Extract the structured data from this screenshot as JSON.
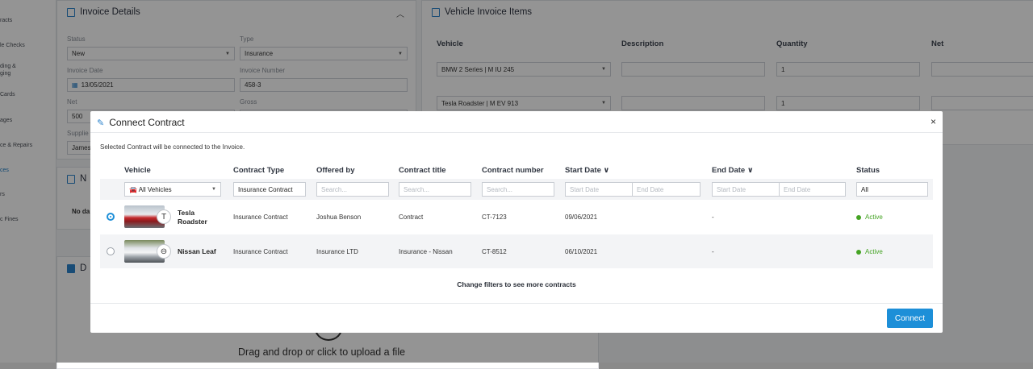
{
  "sidebar": {
    "items": [
      "racts",
      "le Checks",
      "ding &",
      "ging",
      "Cards",
      "ages",
      "ce & Repairs",
      "ces",
      "rs",
      "c Fines"
    ]
  },
  "invoice": {
    "title": "Invoice Details",
    "status_label": "Status",
    "status_value": "New",
    "type_label": "Type",
    "type_value": "Insurance",
    "date_label": "Invoice Date",
    "date_value": "13/05/2021",
    "number_label": "Invoice Number",
    "number_value": "458-3",
    "net_label": "Net",
    "net_value": "500",
    "gross_label": "Gross",
    "supplier_label": "Supplie",
    "supplier_value": "James"
  },
  "notes": {
    "title": "N",
    "text": "No da"
  },
  "documents": {
    "title": "D",
    "upload_text": "Drag and drop or click to upload a file"
  },
  "items_panel": {
    "title": "Vehicle Invoice Items",
    "headers": [
      "Vehicle",
      "Description",
      "Quantity",
      "Net"
    ],
    "rows": [
      {
        "vehicle": "BMW 2 Series | M IU 245",
        "quantity": "1"
      },
      {
        "vehicle": "Tesla Roadster | M EV 913",
        "quantity": "1"
      }
    ]
  },
  "modal": {
    "title": "Connect Contract",
    "close": "×",
    "subtitle": "Selected Contract will be connected to the Invoice.",
    "columns": {
      "vehicle": "Vehicle",
      "type": "Contract Type",
      "offered": "Offered by",
      "title": "Contract title",
      "number": "Contract number",
      "start": "Start Date",
      "end": "End Date",
      "status": "Status",
      "sort_icon": "∨"
    },
    "filters": {
      "vehicle": "All Vehicles",
      "type": "Insurance Contract",
      "search": "Search...",
      "start_date": "Start Date",
      "end_date": "End Date",
      "status": "All"
    },
    "rows": [
      {
        "selected": true,
        "name_line1": "Tesla",
        "name_line2": "Roadster",
        "brand_icon": "T",
        "type": "Insurance Contract",
        "offered": "Joshua Benson",
        "title": "Contract",
        "number": "CT-7123",
        "start": "09/06/2021",
        "end": "-",
        "status": "Active"
      },
      {
        "selected": false,
        "name_line1": "Nissan Leaf",
        "name_line2": "",
        "brand_icon": "⊖",
        "type": "Insurance Contract",
        "offered": "Insurance LTD",
        "title": "Insurance - Nissan",
        "number": "CT-8512",
        "start": "06/10/2021",
        "end": "-",
        "status": "Active"
      }
    ],
    "more_text": "Change filters to see more contracts",
    "connect_label": "Connect"
  },
  "colors": {
    "accent": "#1d8fd8",
    "active_status": "#44a323"
  }
}
